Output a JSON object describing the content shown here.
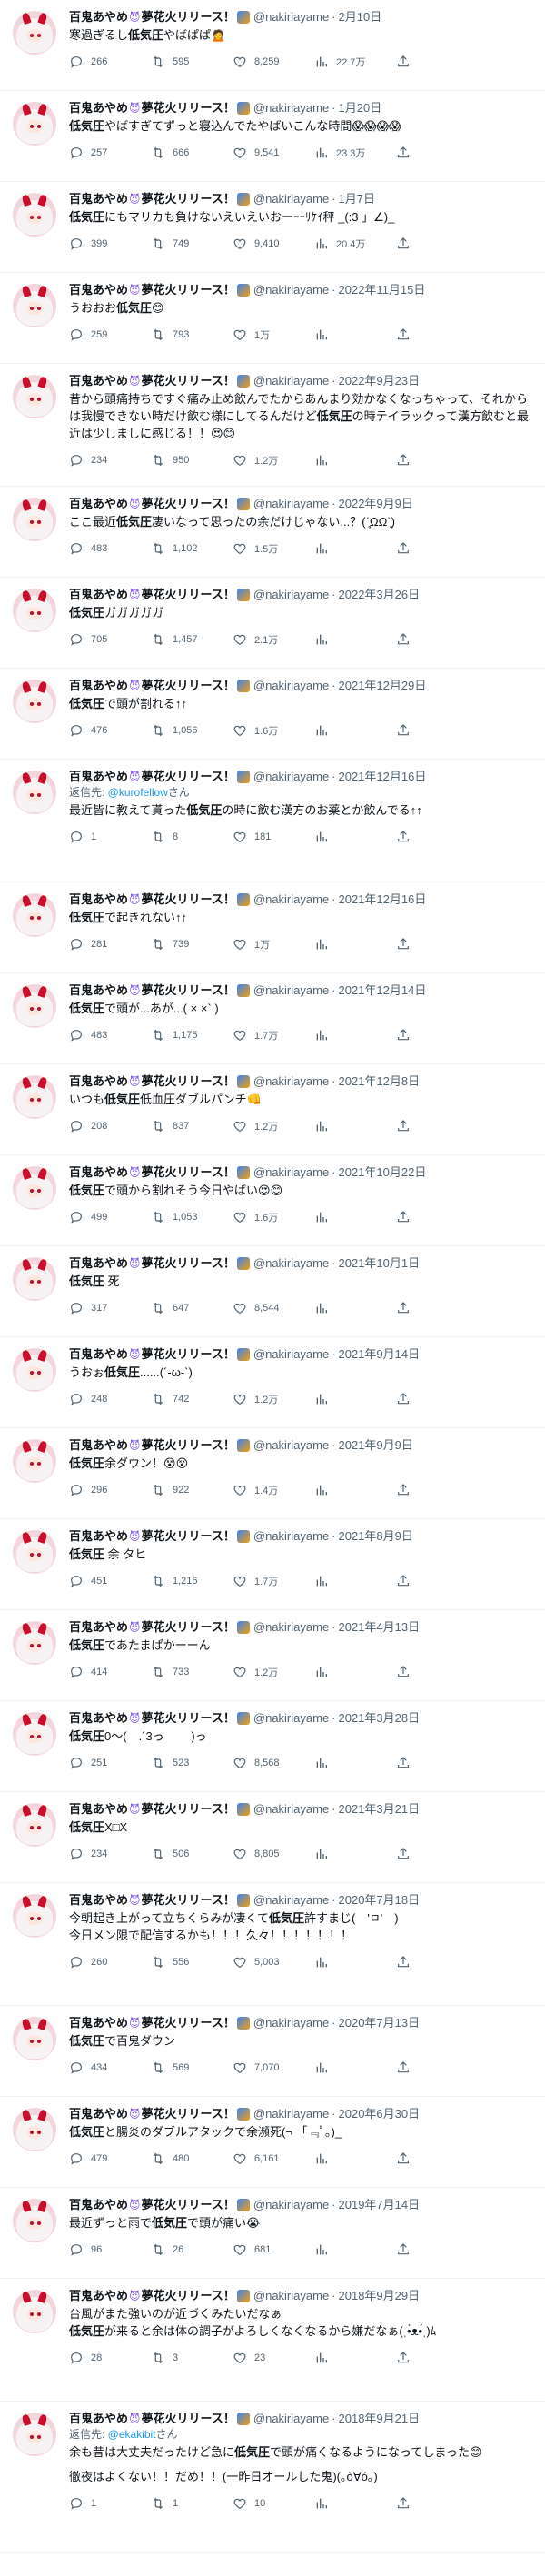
{
  "author": {
    "name": "百鬼あやめ",
    "name_suffix": "夢花火リリース！",
    "devil_emoji": "😈",
    "handle": "@nakiriayame",
    "dot": "·"
  },
  "colors": {
    "accent": "#1d9bf0",
    "muted": "#536471",
    "text": "#0f1419",
    "divider": "#eff3f4"
  },
  "icons": {
    "reply": "reply-icon",
    "retweet": "retweet-icon",
    "like": "heart-icon",
    "views": "views-icon",
    "share": "share-icon"
  },
  "tweets": [
    {
      "date": "2月10日",
      "reply_to_prefix": "",
      "reply_to": "",
      "reply_to_suffix": "",
      "segments": [
        [
          "寒過ぎるし",
          ""
        ],
        [
          "低気圧",
          "hl"
        ],
        [
          "やばぱぱ🙍",
          ""
        ]
      ],
      "extra": "",
      "replies": "266",
      "retweets": "595",
      "likes": "8,259",
      "views": "22.7万"
    },
    {
      "date": "1月20日",
      "reply_to_prefix": "",
      "reply_to": "",
      "reply_to_suffix": "",
      "segments": [
        [
          "低気圧",
          "hl"
        ],
        [
          "やばすぎてずっと寝込んでたやばいこんな時間😱😱😱😱",
          ""
        ]
      ],
      "extra": "",
      "replies": "257",
      "retweets": "666",
      "likes": "9,541",
      "views": "23.3万"
    },
    {
      "date": "1月7日",
      "reply_to_prefix": "",
      "reply_to": "",
      "reply_to_suffix": "",
      "segments": [
        [
          "低気圧",
          "hl"
        ],
        [
          "にもマリカも負けないえいえいおーｰｰﾘｹｲ秤 _(:3 」∠)_",
          ""
        ]
      ],
      "extra": "",
      "replies": "399",
      "retweets": "749",
      "likes": "9,410",
      "views": "20.4万"
    },
    {
      "date": "2022年11月15日",
      "reply_to_prefix": "",
      "reply_to": "",
      "reply_to_suffix": "",
      "segments": [
        [
          "うおおお",
          ""
        ],
        [
          "低気圧",
          "hl"
        ],
        [
          "😊",
          ""
        ]
      ],
      "extra": "",
      "replies": "259",
      "retweets": "793",
      "likes": "1万",
      "views": ""
    },
    {
      "date": "2022年9月23日",
      "reply_to_prefix": "",
      "reply_to": "",
      "reply_to_suffix": "",
      "segments": [
        [
          "昔から頭痛持ちですぐ痛み止め飲んでたからあんまり効かなくなっちゃって、それからは我慢できない時だけ飲む様にしてるんだけど",
          ""
        ],
        [
          "低気圧",
          "hl"
        ],
        [
          "の時テイラックって漢方飲むと最近は少しましに感じる！！😍😊",
          ""
        ]
      ],
      "extra": "",
      "replies": "234",
      "retweets": "950",
      "likes": "1.2万",
      "views": ""
    },
    {
      "date": "2022年9月9日",
      "reply_to_prefix": "",
      "reply_to": "",
      "reply_to_suffix": "",
      "segments": [
        [
          "ここ最近",
          ""
        ],
        [
          "低気圧",
          "hl"
        ],
        [
          "凄いなって思ったの余だけじゃない...？(ˊ̥ΩΩˋ̥)",
          ""
        ]
      ],
      "extra": "",
      "replies": "483",
      "retweets": "1,102",
      "likes": "1.5万",
      "views": ""
    },
    {
      "date": "2022年3月26日",
      "reply_to_prefix": "",
      "reply_to": "",
      "reply_to_suffix": "",
      "segments": [
        [
          "低気圧",
          "hl"
        ],
        [
          "ガガガガガ",
          ""
        ]
      ],
      "extra": "",
      "replies": "705",
      "retweets": "1,457",
      "likes": "2.1万",
      "views": ""
    },
    {
      "date": "2021年12月29日",
      "reply_to_prefix": "",
      "reply_to": "",
      "reply_to_suffix": "",
      "segments": [
        [
          "低気圧",
          "hl"
        ],
        [
          "で頭が割れる↑↑",
          ""
        ]
      ],
      "extra": "",
      "replies": "476",
      "retweets": "1,056",
      "likes": "1.6万",
      "views": ""
    },
    {
      "date": "2021年12月16日",
      "reply_to_prefix": "返信先: ",
      "reply_to": "@kurofellow",
      "reply_to_suffix": "さん",
      "segments": [
        [
          "最近皆に教えて貰った",
          ""
        ],
        [
          "低気圧",
          "hl"
        ],
        [
          "の時に飲む漢方のお薬とか飲んでる↑↑",
          ""
        ]
      ],
      "extra": "",
      "replies": "1",
      "retweets": "8",
      "likes": "181",
      "views": ""
    },
    {
      "date": "2021年12月16日",
      "reply_to_prefix": "",
      "reply_to": "",
      "reply_to_suffix": "",
      "segments": [
        [
          "低気圧",
          "hl"
        ],
        [
          "で起きれない↑↑",
          ""
        ]
      ],
      "extra": "",
      "replies": "281",
      "retweets": "739",
      "likes": "1万",
      "views": ""
    },
    {
      "date": "2021年12月14日",
      "reply_to_prefix": "",
      "reply_to": "",
      "reply_to_suffix": "",
      "segments": [
        [
          "低気圧",
          "hl"
        ],
        [
          "で頭が...あが...( × ×` )",
          ""
        ]
      ],
      "extra": "",
      "replies": "483",
      "retweets": "1,175",
      "likes": "1.7万",
      "views": ""
    },
    {
      "date": "2021年12月8日",
      "reply_to_prefix": "",
      "reply_to": "",
      "reply_to_suffix": "",
      "segments": [
        [
          "いつも",
          ""
        ],
        [
          "低気圧",
          "hl"
        ],
        [
          "低血圧ダブルパンチ👊",
          ""
        ]
      ],
      "extra": "",
      "replies": "208",
      "retweets": "837",
      "likes": "1.2万",
      "views": ""
    },
    {
      "date": "2021年10月22日",
      "reply_to_prefix": "",
      "reply_to": "",
      "reply_to_suffix": "",
      "segments": [
        [
          "低気圧",
          "hl"
        ],
        [
          "で頭から割れそう今日やばい😍😊",
          ""
        ]
      ],
      "extra": "",
      "replies": "499",
      "retweets": "1,053",
      "likes": "1.6万",
      "views": ""
    },
    {
      "date": "2021年10月1日",
      "reply_to_prefix": "",
      "reply_to": "",
      "reply_to_suffix": "",
      "segments": [
        [
          "低気圧",
          "hl"
        ],
        [
          " 死",
          ""
        ]
      ],
      "extra": "",
      "replies": "317",
      "retweets": "647",
      "likes": "8,544",
      "views": ""
    },
    {
      "date": "2021年9月14日",
      "reply_to_prefix": "",
      "reply_to": "",
      "reply_to_suffix": "",
      "segments": [
        [
          "うおぉ",
          ""
        ],
        [
          "低気圧",
          "hl"
        ],
        [
          "......(´-ω-`)",
          ""
        ]
      ],
      "extra": "",
      "replies": "248",
      "retweets": "742",
      "likes": "1.2万",
      "views": ""
    },
    {
      "date": "2021年9月9日",
      "reply_to_prefix": "",
      "reply_to": "",
      "reply_to_suffix": "",
      "segments": [
        [
          "低気圧",
          "hl"
        ],
        [
          "余ダウン！😵😵",
          ""
        ]
      ],
      "extra": "",
      "replies": "296",
      "retweets": "922",
      "likes": "1.4万",
      "views": ""
    },
    {
      "date": "2021年8月9日",
      "reply_to_prefix": "",
      "reply_to": "",
      "reply_to_suffix": "",
      "segments": [
        [
          "低気圧",
          "hl"
        ],
        [
          " 余 タヒ",
          ""
        ]
      ],
      "extra": "",
      "replies": "451",
      "retweets": "1,216",
      "likes": "1.7万",
      "views": ""
    },
    {
      "date": "2021年4月13日",
      "reply_to_prefix": "",
      "reply_to": "",
      "reply_to_suffix": "",
      "segments": [
        [
          "低気圧",
          "hl"
        ],
        [
          "であたまぱかーーん",
          ""
        ]
      ],
      "extra": "",
      "replies": "414",
      "retweets": "733",
      "likes": "1.2万",
      "views": ""
    },
    {
      "date": "2021年3月28日",
      "reply_to_prefix": "",
      "reply_to": "",
      "reply_to_suffix": "",
      "segments": [
        [
          "低気圧",
          "hl"
        ],
        [
          "0〜(　.´3っ　　 )っ",
          ""
        ]
      ],
      "extra": "",
      "replies": "251",
      "retweets": "523",
      "likes": "8,568",
      "views": ""
    },
    {
      "date": "2021年3月21日",
      "reply_to_prefix": "",
      "reply_to": "",
      "reply_to_suffix": "",
      "segments": [
        [
          "低気圧",
          "hl"
        ],
        [
          "X□X",
          ""
        ]
      ],
      "extra": "",
      "replies": "234",
      "retweets": "506",
      "likes": "8,805",
      "views": ""
    },
    {
      "date": "2020年7月18日",
      "reply_to_prefix": "",
      "reply_to": "",
      "reply_to_suffix": "",
      "segments": [
        [
          "今朝起き上がって立ちくらみが凄くて",
          ""
        ],
        [
          "低気圧",
          "hl"
        ],
        [
          "許すまじ(　'ㅁ'　)",
          ""
        ]
      ],
      "extra": "今日メン限で配信するかも！！！久々！！！！！！！",
      "replies": "260",
      "retweets": "556",
      "likes": "5,003",
      "views": ""
    },
    {
      "date": "2020年7月13日",
      "reply_to_prefix": "",
      "reply_to": "",
      "reply_to_suffix": "",
      "segments": [
        [
          "低気圧",
          "hl"
        ],
        [
          "で百鬼ダウン",
          ""
        ]
      ],
      "extra": "",
      "replies": "434",
      "retweets": "569",
      "likes": "7,070",
      "views": ""
    },
    {
      "date": "2020年6月30日",
      "reply_to_prefix": "",
      "reply_to": "",
      "reply_to_suffix": "",
      "segments": [
        [
          "低気圧",
          "hl"
        ],
        [
          "と腸炎のダブルアタックで余瀕死(¬ 「﹃ﾟ｡)_",
          ""
        ]
      ],
      "extra": "",
      "replies": "479",
      "retweets": "480",
      "likes": "6,161",
      "views": ""
    },
    {
      "date": "2019年7月14日",
      "reply_to_prefix": "",
      "reply_to": "",
      "reply_to_suffix": "",
      "segments": [
        [
          "最近ずっと雨で",
          ""
        ],
        [
          "低気圧",
          "hl"
        ],
        [
          "で頭が痛い😭",
          ""
        ]
      ],
      "extra": "",
      "replies": "96",
      "retweets": "26",
      "likes": "681",
      "views": ""
    },
    {
      "date": "2018年9月29日",
      "reply_to_prefix": "",
      "reply_to": "",
      "reply_to_suffix": "",
      "segments": [
        [
          "台風がまた強いのが近づくみたいだなぁ",
          ""
        ]
      ],
      "extra_segments": [
        [
          "低気圧",
          "hl"
        ],
        [
          "が来ると余は体の調子がよろしくなくなるから嫌だなぁ(ˌ•̀ᴥ•́ˌ)ﾑ",
          ""
        ]
      ],
      "extra": "",
      "replies": "28",
      "retweets": "3",
      "likes": "23",
      "views": ""
    },
    {
      "date": "2018年9月21日",
      "reply_to_prefix": "返信先: ",
      "reply_to": "@ekakibit",
      "reply_to_suffix": "さん",
      "segments": [
        [
          "余も昔は大丈夫だったけど急に",
          ""
        ],
        [
          "低気圧",
          "hl"
        ],
        [
          "で頭が痛くなるようになってしまった😊",
          ""
        ]
      ],
      "extra": "徹夜はよくない！！だめ！！(一昨日オールした鬼)(｡ò∀ó｡)",
      "replies": "1",
      "retweets": "1",
      "likes": "10",
      "views": ""
    }
  ]
}
